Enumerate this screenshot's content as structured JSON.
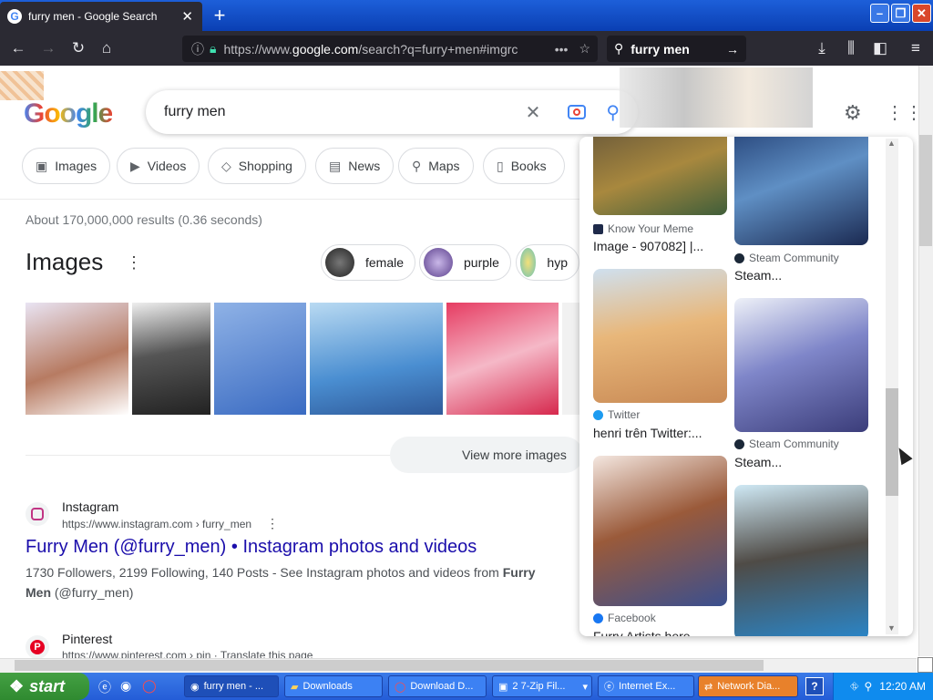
{
  "browser": {
    "tab_title": "furry men - Google Search",
    "url_prefix": "https://www.",
    "url_host": "google.com",
    "url_rest": "/search?q=furry+men#imgrc",
    "search_text": "furry men"
  },
  "google": {
    "logo": "Google",
    "query": "furry men",
    "chips": [
      "Images",
      "Videos",
      "Shopping",
      "News",
      "Maps",
      "Books"
    ],
    "stats": "About 170,000,000 results (0.36 seconds)",
    "images_heading": "Images",
    "pills": [
      "female",
      "purple",
      "hyp"
    ],
    "view_more": "View more images",
    "results": [
      {
        "site": "Instagram",
        "url": "https://www.instagram.com › furry_men",
        "title": "Furry Men (@furry_men) • Instagram photos and videos",
        "snippet_a": "1730 Followers, 2199 Following, 140 Posts - See Instagram photos and videos from ",
        "snippet_b": "Furry",
        "snippet_c": "Men",
        "snippet_d": " (@furry_men)"
      },
      {
        "site": "Pinterest",
        "url": "https://www.pinterest.com › pin",
        "translate": " · Translate this page"
      }
    ]
  },
  "viewer": {
    "items": [
      {
        "source": "Know Your Meme",
        "title": "Image - 907082] |..."
      },
      {
        "source": "Steam Community",
        "title": "Steam..."
      },
      {
        "source": "Twitter",
        "title": "henri trên Twitter:..."
      },
      {
        "source": "Steam Community",
        "title": "Steam..."
      },
      {
        "source": "Facebook",
        "title": "Furry Artists here..."
      }
    ]
  },
  "taskbar": {
    "start": "start",
    "buttons": [
      "furry men - ...",
      "Downloads",
      "Download D...",
      "2 7-Zip Fil...",
      "Internet Ex...",
      "Network Dia..."
    ],
    "clock": "12:20 AM"
  }
}
